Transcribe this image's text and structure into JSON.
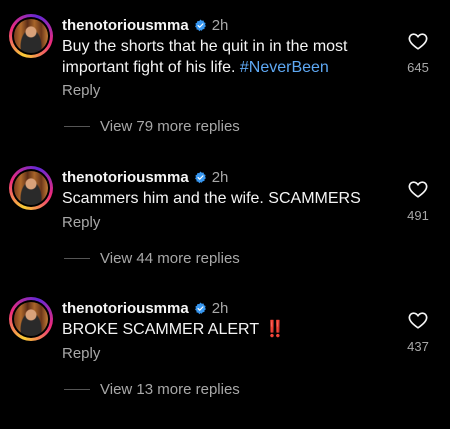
{
  "comments": [
    {
      "username": "thenotoriousmma",
      "time": "2h",
      "text": "Buy the shorts that he quit in in the most important fight of his life. ",
      "hashtag": "#NeverBeen",
      "reply_label": "Reply",
      "view_replies": "View 79 more replies",
      "likes": "645"
    },
    {
      "username": "thenotoriousmma",
      "time": "2h",
      "text": "Scammers him and the wife. SCAMMERS",
      "reply_label": "Reply",
      "view_replies": "View 44 more replies",
      "likes": "491"
    },
    {
      "username": "thenotoriousmma",
      "time": "2h",
      "text": "BROKE SCAMMER ALERT",
      "emoji": "‼️",
      "reply_label": "Reply",
      "view_replies": "View 13 more replies",
      "likes": "437"
    }
  ],
  "colors": {
    "background": "#000000",
    "text": "#f5f5f5",
    "secondary": "#a8a8a8",
    "hashtag": "#5ea8f3",
    "verified": "#3897f0"
  },
  "icons": {
    "verified": "verified-badge-icon",
    "like": "heart-outline-icon"
  }
}
